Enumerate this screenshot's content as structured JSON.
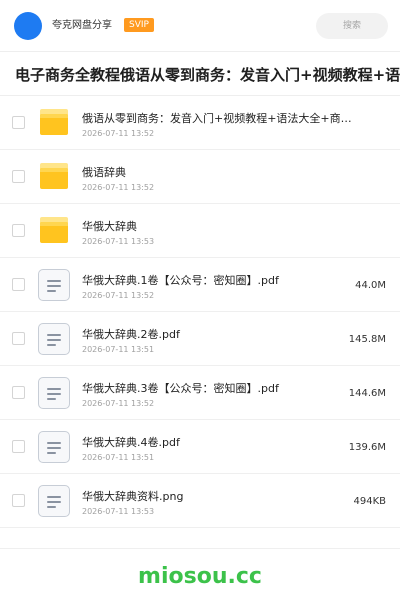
{
  "header": {
    "user_name": "夸克网盘分享",
    "badge": "SVIP",
    "search_placeholder": "搜索"
  },
  "folder_title": "电子商务全教程俄语从零到商务：发音入门+视频教程+语法大全+商务",
  "items": [
    {
      "type": "folder",
      "name": "俄语从零到商务：发音入门+视频教程+语法大全+商务…",
      "date": "2026-07-11 13:52",
      "size": ""
    },
    {
      "type": "folder",
      "name": "俄语辞典",
      "date": "2026-07-11 13:52",
      "size": ""
    },
    {
      "type": "folder",
      "name": "华俄大辞典",
      "date": "2026-07-11 13:53",
      "size": ""
    },
    {
      "type": "file",
      "name": "华俄大辞典.1卷【公众号：密知圈】.pdf",
      "date": "2026-07-11 13:52",
      "size": "44.0M"
    },
    {
      "type": "file",
      "name": "华俄大辞典.2卷.pdf",
      "date": "2026-07-11 13:51",
      "size": "145.8M"
    },
    {
      "type": "file",
      "name": "华俄大辞典.3卷【公众号：密知圈】.pdf",
      "date": "2026-07-11 13:52",
      "size": "144.6M"
    },
    {
      "type": "file",
      "name": "华俄大辞典.4卷.pdf",
      "date": "2026-07-11 13:51",
      "size": "139.6M"
    },
    {
      "type": "file",
      "name": "华俄大辞典资料.png",
      "date": "2026-07-11 13:53",
      "size": "494KB"
    }
  ],
  "watermark": "miosou.cc",
  "colors": {
    "accent": "#1e7bf2",
    "badge": "#ff9a1f",
    "folder": "#ffc41f",
    "watermark": "#3cc24a"
  }
}
